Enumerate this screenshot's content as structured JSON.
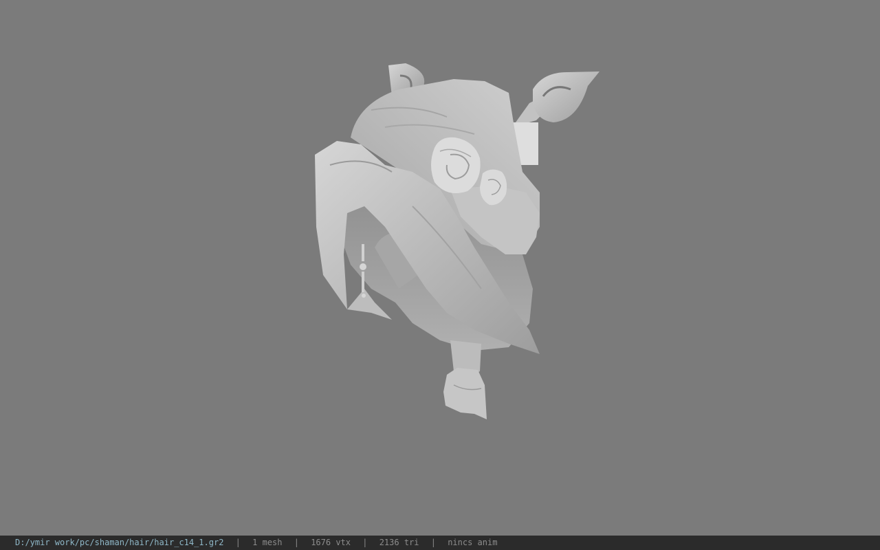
{
  "statusbar": {
    "file_path": "D:/ymir work/pc/shaman/hair/hair_c14_1.gr2",
    "separator": "|",
    "mesh_count": "1 mesh",
    "vertex_count": "1676 vtx",
    "triangle_count": "2136 tri",
    "animation": "nincs anim"
  },
  "viewport": {
    "background_color": "#7b7b7b",
    "model_color": "#c8c8c8"
  }
}
